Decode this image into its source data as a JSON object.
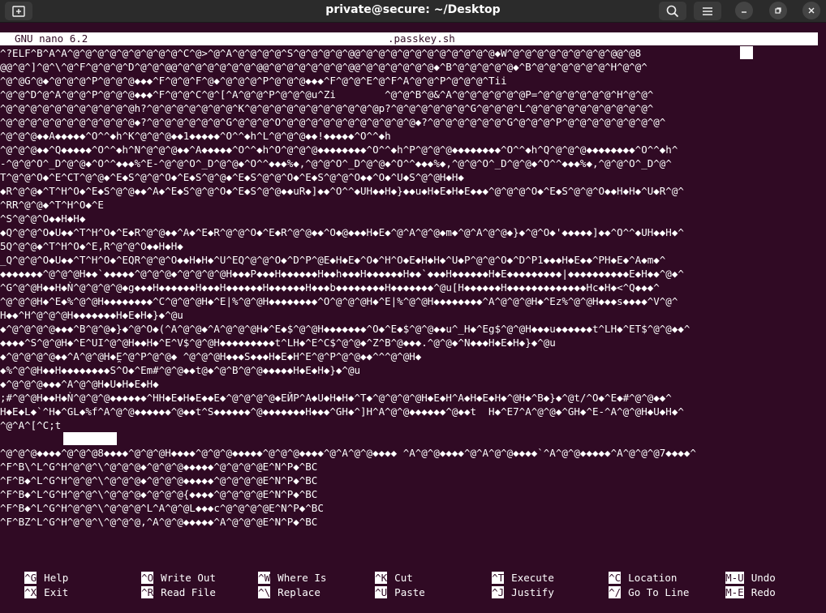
{
  "window": {
    "title": "private@secure: ~/Desktop"
  },
  "nano": {
    "app": "GNU nano 6.2",
    "filename": ".passkey.sh"
  },
  "lines": [
    "^?ELF^B^A^A^@^@^@^@^@^@^@^@^@^C^@>^@^A^@^@^@^@^S^@^@^@^@^@@^@^@^@^@^@^@^@^@^@^@^@◆W^@^@^@^@^@^@^@^@^@@^@8",
    "@@^@^]^@^\\^@^F^@^@^@^D^@^@^@@^@^@^@^@^@^@^@@^@^@^@^@^@^@^@@^@^@^@^@^@^@◆^B^@^@^@^@^@◆^B^@^@^@^@^@^@^H^@^@^",
    "^@^@G^@◆^@^@^@^P^@^@^@◆◆◆^F^@^@^F^@◆^@^@^@^P^@^@^@◆◆◆^F^@^@^E^@^F^A^@^@^P^@^@^@^Tii",
    "^@^@^D^@^A^@^@^P^@^@^@◆◆◆^F^@^@^C^@^[^A^@^@^P^@^@^@u^Zi        ^@^@^B^@&^A^@^@^@^@^@^@P=^@^@^@^@^@^@^H^@^@^",
    "^@^@^@^@^@^@^@^@^@^@^@h?^@^@^@^@^@^@^@^K^@^@^@^@^@^@^@^@^@^@^@p?^@^@^@^@^@^@^G^@^@^@^L^@^@^@^@^@^@^@^@^@^@^",
    "^@^@^@^@^@^@^@^@^@^@^@◆?^@^@^@^@^@^@^G^@^@^@^O^@^@^@^@^@^@^@^@^@^@^@◆?^@^@^@^@^@^@^G^@^@^@^P^@^@^@^@^@^@^@^@^",
    "^@^@^@◆◆A◆◆◆◆◆^O^^◆h^K^@^@^@◆◆1◆◆◆◆◆^O^^◆h^L^@^@^@◆◆!◆◆◆◆◆^O^^◆h",
    "^@^@^@◆◆^Q◆◆◆◆◆^O^^◆h^N^@^@^@◆◆^A◆◆◆◆◆^O^^◆h^O^@^@^@◆◆◆◆◆◆◆◆^O^^◆h^P^@^@^@◆◆◆◆◆◆◆◆^O^^◆h^Q^@^@^@◆◆◆◆◆◆◆◆^O^^◆h^",
    "-^@^@^O^_D^@^@◆^O^^◆◆◆%^E-^@^@^O^_D^@^@◆^O^^◆◆◆%◆,^@^@^O^_D^@^@◆^O^^◆◆◆%◆,^@^@^O^_D^@^@◆^O^^◆◆◆%◆,^@^@^O^_D^@^",
    "T^@^@^O◆^E^CT^@^@◆^E◆S^@^@^O◆^E◆S^@^@◆^E◆S^@^@^O◆^E◆S^@^@^O◆◆^O◆^U◆S^@^@H◆H◆",
    "◆R^@^@◆^T^H^O◆^E◆S^@^@◆◆^A◆^E◆S^@^@^O◆^E◆S^@^@◆◆uR◆]◆◆^O^^◆UH◆◆H◆}◆◆u◆H◆E◆H◆E◆◆◆^@^@^@^O◆^E◆S^@^@^O◆◆H◆H◆^U◆R^@^",
    "^RR^@^@◆^T^H^O◆^E",
    "^S^@^@^O◆◆H◆H◆",
    "◆Q^@^@^O◆U◆◆^T^H^O◆^E◆R^@^@◆◆^A◆^E◆R^@^@^O◆^E◆R^@^@◆◆^O◆@◆◆◆H◆E◆^@^A^@^@◆m◆^@^A^@^@◆}◆^@^O◆'◆◆◆◆◆]◆◆^O^^◆UH◆◆H◆^",
    "5Q^@^@◆^T^H^O◆^E,R^@^@^O◆◆H◆H◆",
    "_Q^@^@^O◆U◆◆^T^H^O◆^EQR^@^@^O◆◆H◆H◆^U^EQ^@^@^O◆^D^P^@E◆H◆E◆^O◆^H^O◆E◆H◆H◆^U◆P^@^@^O◆^D^P1◆◆◆H◆E◆◆^PH◆E◆^A◆m◆^",
    "◆◆◆◆◆◆◆^@^@^@H◆◆`◆◆◆◆◆^@^@^@◆^@^@^@^@H◆◆◆P◆◆◆H◆◆◆◆◆◆H◆◆h◆◆◆H◆◆◆◆◆◆H◆◆`◆◆◆H◆◆◆◆◆◆H◆E◆◆◆◆◆◆◆◆◆|◆◆◆◆◆◆◆◆◆◆E◆H◆◆^@◆^",
    "^G^@^@H◆◆H◆Ǹ^@^@^@^@◆g◆◆◆H◆◆◆◆◆◆H◆◆◆H◆◆◆◆◆◆H◆◆◆◆◆◆H◆◆◆b◆◆◆◆◆◆◆◆H◆◆◆◆◆◆◆^@u[H◆◆◆◆◆◆H◆◆◆◆◆◆◆◆◆◆◆◆◆Hc◆H◆<^Q◆◆◆^",
    "^@^@^@H◆^E◆%^@^@H◆◆◆◆◆◆◆◆^C^@^@^@H◆^E|%^@^@H◆◆◆◆◆◆◆◆^O^@^@^@H◆^E|%^@^@H◆◆◆◆◆◆◆◆^A^@^@^@H◆^Ez%^@^@H◆◆◆s◆◆◆◆^V^@^",
    "H◆◆^H^@^@^@H◆◆◆◆◆◆◆H◆E◆H◆}◆^@u",
    "◆^@^@^@^@◆◆◆^B^@^@◆}◆^@^O◆(^A^@^@◆^A^@^@^@H◆^E◆$^@^@H◆◆◆◆◆◆◆^O◆^E◆$^@^@◆◆u^_H◆^Eg$^@^@H◆◆◆u◆◆◆◆◆◆t^LH◆^ET$^@^@◆◆^",
    "◆◆◆◆^S^@^@H◆^E^UI^@^@H◆◆H◆^E^V$^@^@H◆◆◆◆◆◆◆◆◆t^LH◆^E^C$^@^@◆^Z^B^@◆◆◆.^@^@◆^N◆◆◆H◆E◆H◆}◆^@u",
    "◆^@^@^@^@◆◆^A^@^@H◆E̯^@^P^@^@◆ ^@^@^@H◆◆◆S◆◆◆H◆E◆H^E^@^P^@^@◆◆^^^@^@H◆",
    "◆%^@^@H◆◆H◆◆◆◆◆◆◆◆S^O◆^Em#^@^@◆◆t@◆^@^B^@^@◆◆◆◆◆H◆E◆H◆}◆^@u",
    "◆^@^@^@◆◆◆^A^@^@H◆U◆H◆E◆H◆",
    ";#^@^@H◆◆H◆Ǹ^@^@^@◆◆◆◆◆◆^HH◆E◆H◆E◆◆E◆^@^@^@^@◆EЙР^A◆U◆H◆H◆^T◆^@^@^@^@H◆E◆H^A◆H◆E◆H◆^@H◆^B◆}◆^@t/^O◆^E◆#^@^@◆◆^",
    "H◆E◆L◆`^H◆^GL◆%f^A^@^@◆◆◆◆◆◆^@◆◆t^S◆◆◆◆◆◆^@◆◆◆◆◆◆◆H◆◆◆^GH◆^]H^A^@^@◆◆◆◆◆◆^@◆◆t  H◆^E7^A^@^@◆^GH◆^E-^A^@^@H◆U◆H◆^",
    "^@^A^[^C;t",
    "^@^@^@◆◆◆◆^@^@^@8◆◆◆◆^@^@^@H◆◆◆◆^@^@^@◆◆◆◆◆^@^@^@◆◆◆◆^@^A^@^@◆◆◆◆ ^A^@^@◆◆◆◆^@^A^@^@◆◆◆◆`^A^@^@◆◆◆◆◆^A^@^@^@7◆◆◆◆^",
    "^F^B\\^L^G^H^@^@^\\^@^@^@◆^@^@^@◆◆◆◆◆^@^@^@^@E^N^P◆^BC",
    "^F^B◆^L^G^H^@^@^\\^@^@^@◆^@^@^@◆◆◆◆◆^@^@^@^@E^N^P◆^BC",
    "^F^B◆^L^G^H^@^@^\\^@^@^@◆^@^@^@{◆◆◆◆^@^@^@^@E^N^P◆^BC",
    "^F^B◆^L^G^H^@^@^\\^@^@^@^L^A^@^@L◆◆◆c^@^@^@^@E^N^P◆^BC",
    "^F^BZ^L^G^H^@^@^\\^@^@^@,^A^@^@◆◆◆◆◆^A^@^@^@E^N^P◆^BC"
  ],
  "shortcuts": [
    {
      "key": "^G",
      "label": "Help"
    },
    {
      "key": "^X",
      "label": "Exit"
    },
    {
      "key": "^O",
      "label": "Write Out"
    },
    {
      "key": "^R",
      "label": "Read File"
    },
    {
      "key": "^W",
      "label": "Where Is"
    },
    {
      "key": "^\\",
      "label": "Replace"
    },
    {
      "key": "^K",
      "label": "Cut"
    },
    {
      "key": "^U",
      "label": "Paste"
    },
    {
      "key": "^T",
      "label": "Execute"
    },
    {
      "key": "^J",
      "label": "Justify"
    },
    {
      "key": "^C",
      "label": "Location"
    },
    {
      "key": "^/",
      "label": "Go To Line"
    },
    {
      "key": "M-U",
      "label": "Undo"
    },
    {
      "key": "M-E",
      "label": "Redo"
    }
  ],
  "colors": {
    "background": "#300a24",
    "foreground": "#ffffff",
    "titlebar": "#2b2b2b"
  }
}
